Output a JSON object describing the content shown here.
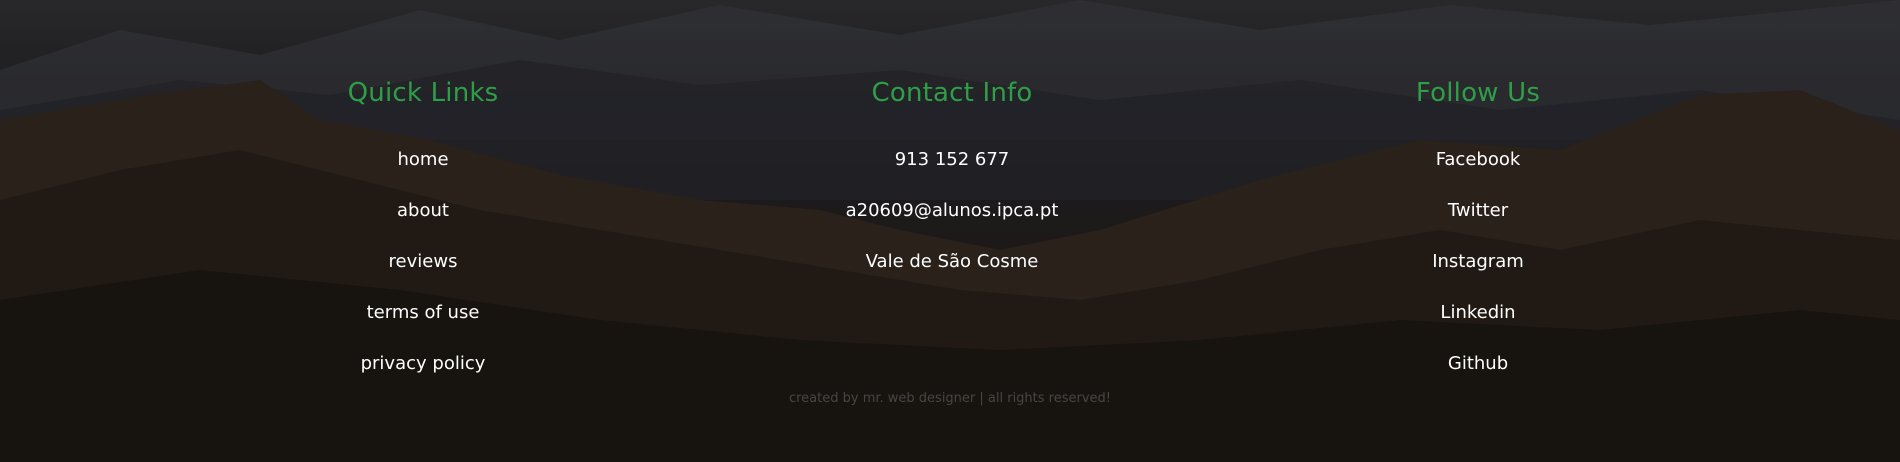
{
  "sections": {
    "quick_links": {
      "title": "Quick Links",
      "items": [
        "home",
        "about",
        "reviews",
        "terms of use",
        "privacy policy"
      ]
    },
    "contact_info": {
      "title": "Contact Info",
      "items": [
        "913 152 677",
        "a20609@alunos.ipca.pt",
        "Vale de São Cosme"
      ]
    },
    "follow_us": {
      "title": "Follow Us",
      "items": [
        "Facebook",
        "Twitter",
        "Instagram",
        "Linkedin",
        "Github"
      ]
    }
  },
  "credit": "created by mr. web designer | all rights reserved!",
  "colors": {
    "accent": "#2e9e47",
    "text": "#ffffff"
  }
}
